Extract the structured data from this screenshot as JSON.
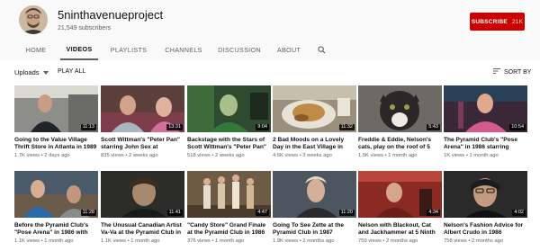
{
  "channel": {
    "name": "5ninthavenueproject",
    "subscribers": "21,549 subscribers",
    "subscribe_label": "SUBSCRIBE",
    "subscribe_count": "21K",
    "subscribe_color": "#cc0000"
  },
  "tabs": [
    {
      "label": "HOME"
    },
    {
      "label": "VIDEOS",
      "active": true
    },
    {
      "label": "PLAYLISTS"
    },
    {
      "label": "CHANNELS"
    },
    {
      "label": "DISCUSSION"
    },
    {
      "label": "ABOUT"
    }
  ],
  "search_icon": "search-icon",
  "filter": {
    "uploads_label": "Uploads",
    "play_all_label": "PLAY ALL",
    "sort_label": "SORT BY"
  },
  "videos": [
    {
      "title": "Going to the Value Village Thrift Store in Atlanta in 1989",
      "duration": "11:13",
      "views": "1.7K views",
      "age": "2 days ago"
    },
    {
      "title": "Scott Wittman's \"Peter Pan\" starring John Sex at",
      "duration": "13:31",
      "views": "835 views",
      "age": "2 weeks ago"
    },
    {
      "title": "Backstage with the Stars of Scott Wittman's \"Peter Pan\"",
      "duration": "9:04",
      "views": "518 views",
      "age": "2 weeks ago"
    },
    {
      "title": "2 Bad Moods on a Lovely Day in the East Village in 1986",
      "duration": "11:32",
      "views": "4.5K views",
      "age": "3 weeks ago"
    },
    {
      "title": "Freddie & Eddie, Nelson's cats, play on the roof of 5",
      "duration": "5:43",
      "views": "1.5K views",
      "age": "1 month ago"
    },
    {
      "title": "The Pyramid Club's \"Pose Arena\" in 1986 starring",
      "duration": "10:54",
      "views": "1K views",
      "age": "1 month ago"
    },
    {
      "title": "Before the Pyramid Club's \"Pose Arena\" in 1986 with",
      "duration": "11:28",
      "views": "1.1K views",
      "age": "1 month ago"
    },
    {
      "title": "The Unusual Canadian Artist Va-Va at the Pyramid Club in",
      "duration": "11:41",
      "views": "1.1K views",
      "age": "1 month ago"
    },
    {
      "title": "\"Candy Store\" Grand Finale at the Pyramid Club in 1986",
      "duration": "4:47",
      "views": "376 views",
      "age": "1 month ago"
    },
    {
      "title": "Going To See Zette at the Pyramid Club in 1987",
      "duration": "11:20",
      "views": "1.9K views",
      "age": "2 months ago"
    },
    {
      "title": "Nelson with Blackout, Cat and Jackhammer at 5 Ninth",
      "duration": "4:34",
      "views": "759 views",
      "age": "2 months ago"
    },
    {
      "title": "Nelson's Fashion Advice for Albert Crudo in 1986",
      "duration": "4:02",
      "views": "758 views",
      "age": "2 months ago"
    }
  ]
}
